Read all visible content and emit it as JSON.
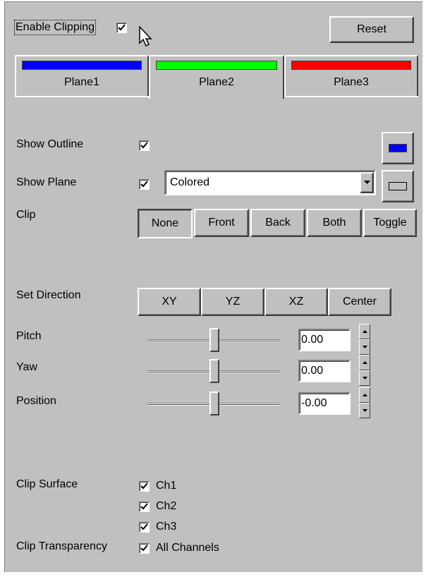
{
  "header": {
    "enable_clipping_label": "Enable Clipping",
    "enable_clipping_checked": true,
    "reset_label": "Reset"
  },
  "planes": [
    {
      "label": "Plane1",
      "color": "#0000ff",
      "selected": false
    },
    {
      "label": "Plane2",
      "color": "#00ff00",
      "selected": true
    },
    {
      "label": "Plane3",
      "color": "#ff0000",
      "selected": false
    }
  ],
  "options": {
    "show_outline_label": "Show Outline",
    "show_outline_checked": true,
    "outline_color": "#0000ff",
    "show_plane_label": "Show Plane",
    "show_plane_checked": true,
    "plane_mode_value": "Colored",
    "plane_swatch_color": "#c0c0c0",
    "clip_label": "Clip",
    "clip_buttons": [
      "None",
      "Front",
      "Back",
      "Both",
      "Toggle"
    ],
    "clip_selected": "None"
  },
  "direction": {
    "label": "Set Direction",
    "buttons": [
      "XY",
      "YZ",
      "XZ",
      "Center"
    ]
  },
  "sliders": [
    {
      "label": "Pitch",
      "value": "0.00",
      "level": 0.5
    },
    {
      "label": "Yaw",
      "value": "0.00",
      "level": 0.5
    },
    {
      "label": "Position",
      "value": "-0.00",
      "level": 0.5
    }
  ],
  "clip_surface": {
    "label": "Clip Surface",
    "channels": [
      {
        "label": "Ch1",
        "checked": true
      },
      {
        "label": "Ch2",
        "checked": true
      },
      {
        "label": "Ch3",
        "checked": true
      }
    ]
  },
  "clip_transparency": {
    "label": "Clip Transparency",
    "all_channels_label": "All Channels",
    "checked": true
  }
}
